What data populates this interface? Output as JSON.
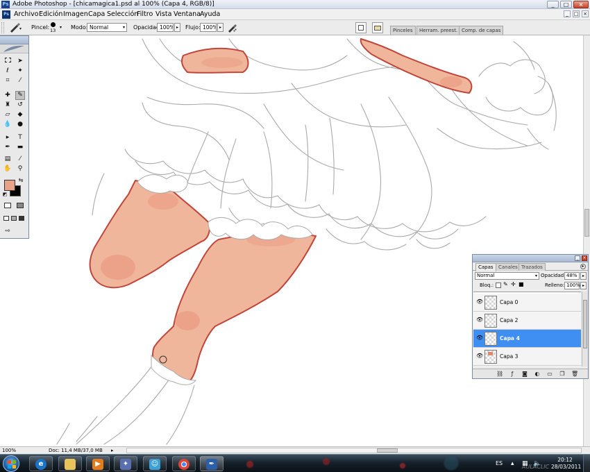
{
  "window": {
    "title": "Adobe Photoshop - [chicamagica1.psd al 100% (Capa 4, RGB/8)]",
    "app_icon_text": "Ps",
    "min": "_",
    "max": "□",
    "close": "×"
  },
  "menu": {
    "items": [
      "Archivo",
      "Edición",
      "Imagen",
      "Capa",
      "Selección",
      "Filtro",
      "Vista",
      "Ventana",
      "Ayuda"
    ],
    "doc_buttons": [
      "_",
      "□",
      "×"
    ]
  },
  "options": {
    "brush_label": "Pincel:",
    "brush_size": "13",
    "mode_label": "Modo:",
    "mode_value": "Normal",
    "opacity_label": "Opacidad:",
    "opacity_value": "100%",
    "flow_label": "Flujo:",
    "flow_value": "100%",
    "arrow": "▸",
    "dropdown_arrow": "▾"
  },
  "palette_well": {
    "tabs": [
      "Pinceles",
      "Herram. preest.",
      "Comp. de capas"
    ]
  },
  "toolbox": {
    "foreground_color": "#e6a38a",
    "background_color": "#000000"
  },
  "layers_panel": {
    "tabs": [
      "Capas",
      "Canales",
      "Trazados"
    ],
    "blend_mode": "Normal",
    "opacity_label": "Opacidad:",
    "opacity_value": "48%",
    "lock_label": "Bloq.:",
    "fill_label": "Relleno:",
    "fill_value": "100%",
    "layers": [
      {
        "name": "Capa 0",
        "active": false
      },
      {
        "name": "Capa 2",
        "active": false
      },
      {
        "name": "Capa 4",
        "active": true
      },
      {
        "name": "Capa 3",
        "active": false
      }
    ]
  },
  "status": {
    "zoom": "100%",
    "doc": "Doc: 11,4 MB/37,0 MB"
  },
  "taskbar": {
    "lang": "ES",
    "time": "20:12",
    "date": "28/03/2011",
    "watermark": "AULACLIC"
  },
  "colors": {
    "skin": "#f0b69b",
    "skin_shadow": "#e8917a",
    "outline": "#c0453a",
    "sketch": "#a8a8a8",
    "selection_blue": "#3f8ef2"
  }
}
